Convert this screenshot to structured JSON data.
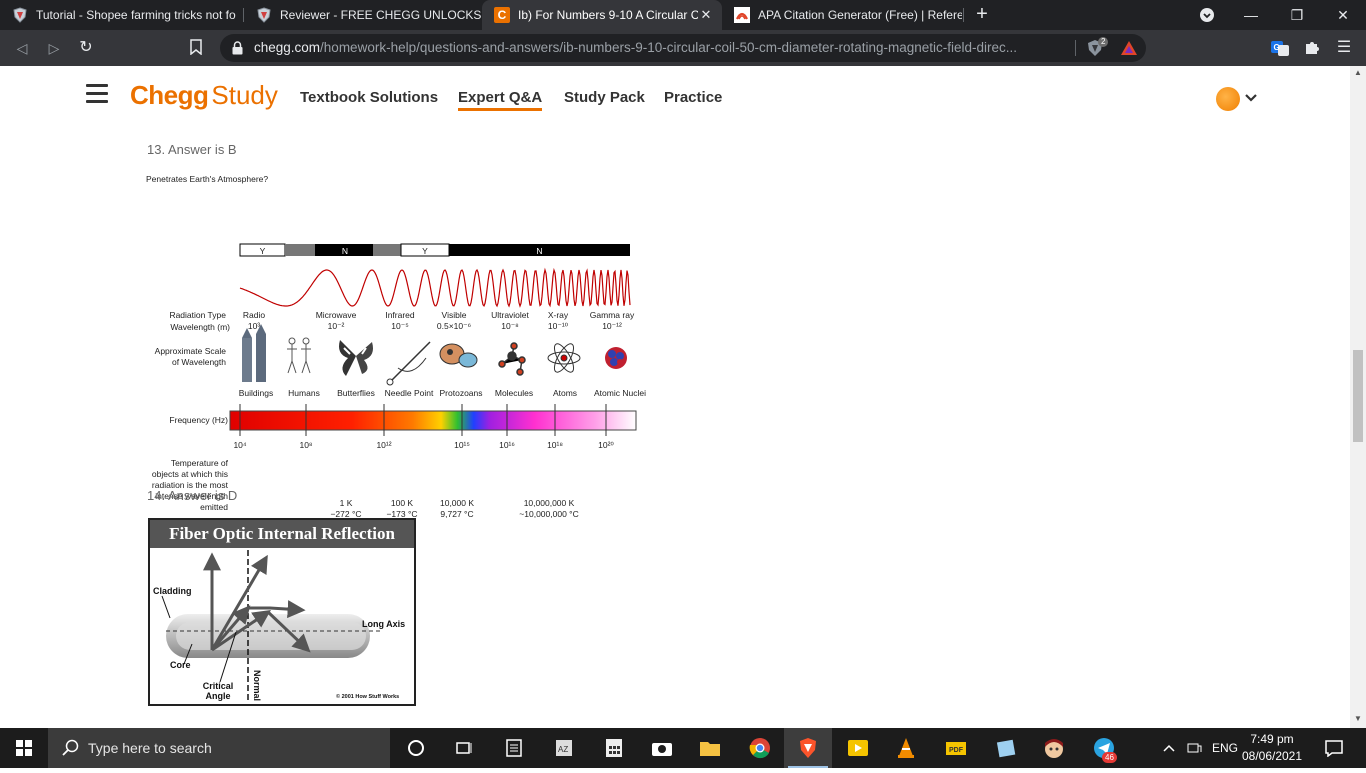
{
  "browser": {
    "tabs": [
      {
        "title": "Tutorial - Shopee farming tricks not fo",
        "active": false
      },
      {
        "title": "Reviewer - FREE CHEGG UNLOCKS | Pa",
        "active": false
      },
      {
        "title": "Ib) For Numbers 9-10 A Circular C",
        "active": true
      },
      {
        "title": "APA Citation Generator (Free) | Referer",
        "active": false
      }
    ],
    "new_tab": "+",
    "url_domain": "chegg.com",
    "url_path": "/homework-help/questions-and-answers/ib-numbers-9-10-circular-coil-50-cm-diameter-rotating-magnetic-field-direc...",
    "shield_badge": "2"
  },
  "chegg": {
    "logo_chegg": "Chegg",
    "logo_study": "Study",
    "nav": [
      "Textbook Solutions",
      "Expert Q&A",
      "Study Pack",
      "Practice"
    ],
    "active_nav": "Expert Q&A"
  },
  "content": {
    "answer13": "13. Answer is B",
    "answer14": "14. Answer is D",
    "spectrum": {
      "penetrates_label": "Penetrates Earth's Atmosphere?",
      "atm_bars": [
        "Y",
        "N",
        "Y",
        "N"
      ],
      "radiation_type_label": "Radiation Type",
      "wavelength_label": "Wavelength (m)",
      "types": [
        {
          "name": "Radio",
          "wl": "10³"
        },
        {
          "name": "Microwave",
          "wl": "10⁻²"
        },
        {
          "name": "Infrared",
          "wl": "10⁻⁵"
        },
        {
          "name": "Visible",
          "wl": "0.5×10⁻⁶"
        },
        {
          "name": "Ultraviolet",
          "wl": "10⁻⁸"
        },
        {
          "name": "X-ray",
          "wl": "10⁻¹⁰"
        },
        {
          "name": "Gamma ray",
          "wl": "10⁻¹²"
        }
      ],
      "scale_label": "Approximate Scale of Wavelength",
      "scale_items": [
        "Buildings",
        "Humans",
        "Butterflies",
        "Needle Point",
        "Protozoans",
        "Molecules",
        "Atoms",
        "Atomic Nuclei"
      ],
      "frequency_label": "Frequency (Hz)",
      "frequencies": [
        "10⁴",
        "10⁸",
        "10¹²",
        "10¹⁵",
        "10¹⁶",
        "10¹⁸",
        "10²⁰"
      ],
      "temperature_label": "Temperature of objects at which this radiation is the most intense wavelength emitted",
      "temperatures": [
        {
          "k": "1 K",
          "c": "−272 °C"
        },
        {
          "k": "100 K",
          "c": "−173 °C"
        },
        {
          "k": "10,000 K",
          "c": "9,727 °C"
        },
        {
          "k": "10,000,000 K",
          "c": "~10,000,000 °C"
        }
      ]
    },
    "fiber": {
      "title": "Fiber Optic Internal Reflection",
      "cladding": "Cladding",
      "core": "Core",
      "long_axis": "Long Axis",
      "critical_angle": "Critical Angle",
      "normal": "Normal",
      "copyright": "© 2001 How Stuff Works"
    }
  },
  "taskbar": {
    "search_placeholder": "Type here to search",
    "lang": "ENG",
    "time": "7:49 pm",
    "date": "08/06/2021",
    "telegram_badge": "46"
  }
}
